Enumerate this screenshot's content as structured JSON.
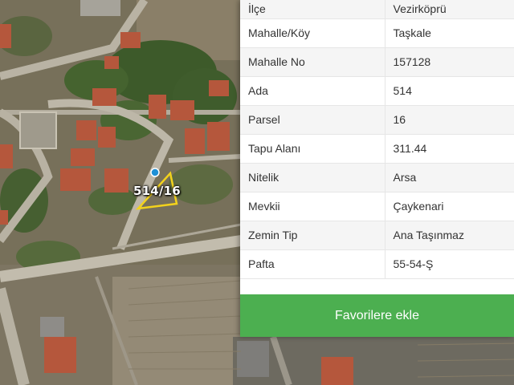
{
  "map": {
    "parcel_label": "514/16"
  },
  "panel": {
    "rows": [
      {
        "key": "İlçe",
        "value": "Vezirköprü"
      },
      {
        "key": "Mahalle/Köy",
        "value": "Taşkale"
      },
      {
        "key": "Mahalle No",
        "value": "157128"
      },
      {
        "key": "Ada",
        "value": "514"
      },
      {
        "key": "Parsel",
        "value": "16"
      },
      {
        "key": "Tapu Alanı",
        "value": "311.44"
      },
      {
        "key": "Nitelik",
        "value": "Arsa"
      },
      {
        "key": "Mevkii",
        "value": "Çaykenari"
      },
      {
        "key": "Zemin Tip",
        "value": "Ana Taşınmaz"
      },
      {
        "key": "Pafta",
        "value": "55-54-Ş"
      }
    ],
    "favorite_button_label": "Favorilere ekle"
  },
  "colors": {
    "button_green": "#4caf50",
    "parcel_outline": "#f2d21c",
    "location_dot": "#1e90d6"
  }
}
